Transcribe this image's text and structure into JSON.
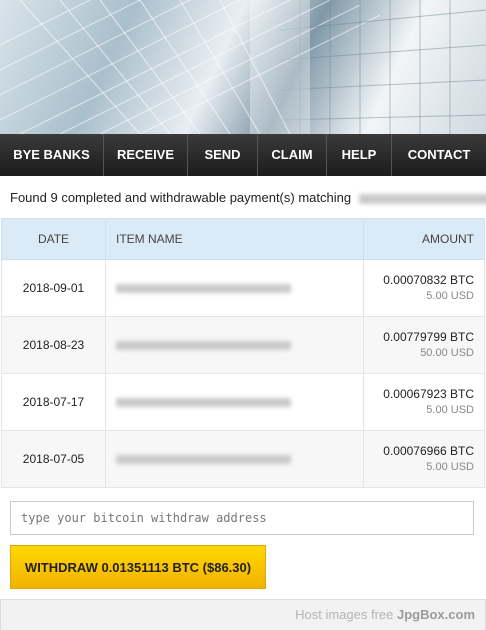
{
  "nav": {
    "items": [
      {
        "label": "BYE BANKS"
      },
      {
        "label": "RECEIVE"
      },
      {
        "label": "SEND"
      },
      {
        "label": "CLAIM"
      },
      {
        "label": "HELP"
      },
      {
        "label": "CONTACT"
      }
    ]
  },
  "summary": {
    "text": "Found 9 completed and withdrawable payment(s) matching"
  },
  "table": {
    "headers": {
      "date": "DATE",
      "item": "ITEM NAME",
      "amount": "AMOUNT"
    },
    "rows": [
      {
        "date": "2018-09-01",
        "btc": "0.00070832 BTC",
        "usd": "5.00 USD"
      },
      {
        "date": "2018-08-23",
        "btc": "0.00779799 BTC",
        "usd": "50.00 USD"
      },
      {
        "date": "2018-07-17",
        "btc": "0.00067923 BTC",
        "usd": "5.00 USD"
      },
      {
        "date": "2018-07-05",
        "btc": "0.00076966 BTC",
        "usd": "5.00 USD"
      }
    ]
  },
  "withdraw": {
    "placeholder": "type your bitcoin withdraw address",
    "button_label": "WITHDRAW 0.01351113 BTC ($86.30)"
  },
  "footer": {
    "watermark_prefix": "Host images free ",
    "watermark_brand": "JpgBox.com"
  },
  "colors": {
    "nav_bg": "#1c1c1c",
    "header_bg": "#dbeaf7",
    "button_yellow": "#ffd800"
  }
}
